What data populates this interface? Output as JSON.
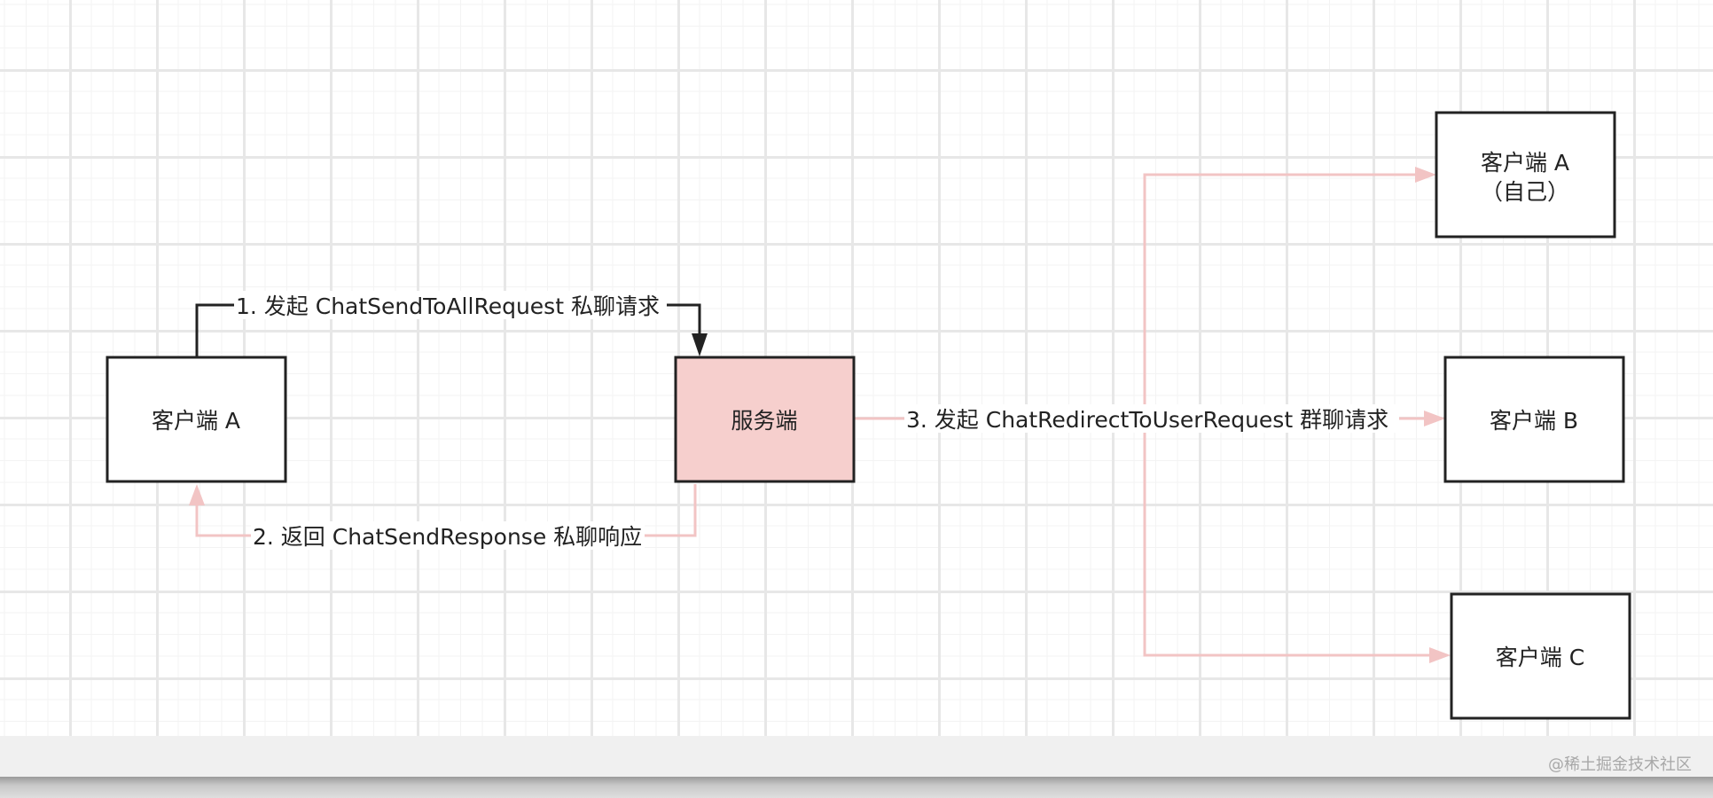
{
  "nodes": {
    "client_a_left": {
      "line1": "客户端 A"
    },
    "server": {
      "line1": "服务端"
    },
    "client_a_self": {
      "line1": "客户端 A",
      "line2": "（自己）"
    },
    "client_b": {
      "line1": "客户端 B"
    },
    "client_c": {
      "line1": "客户端 C"
    }
  },
  "edges": {
    "step1": "1. 发起 ChatSendToAllRequest 私聊请求",
    "step2": "2. 返回 ChatSendResponse 私聊响应",
    "step3": "3. 发起 ChatRedirectToUserRequest 群聊请求"
  },
  "colors": {
    "server_fill": "#f6cfcd",
    "pink_edge": "#f2c4c4",
    "dark_edge": "#222222"
  },
  "watermark": "@稀土掘金技术社区"
}
